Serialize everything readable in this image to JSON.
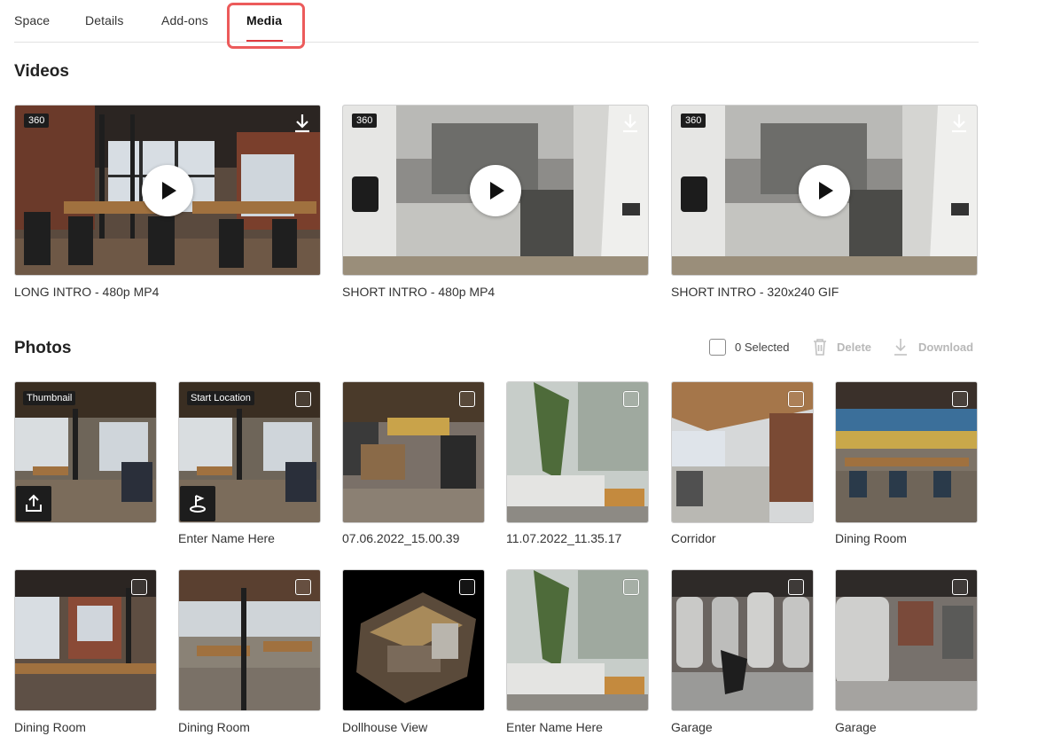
{
  "tabs": [
    {
      "label": "Space"
    },
    {
      "label": "Details"
    },
    {
      "label": "Add-ons"
    },
    {
      "label": "Media"
    }
  ],
  "videos": {
    "title": "Videos",
    "items": [
      {
        "label": "LONG INTRO - 480p MP4",
        "badge": "360"
      },
      {
        "label": "SHORT INTRO - 480p MP4",
        "badge": "360"
      },
      {
        "label": "SHORT INTRO - 320x240 GIF",
        "badge": "360"
      }
    ]
  },
  "photos": {
    "title": "Photos",
    "selected_text": "0 Selected",
    "delete_label": "Delete",
    "download_label": "Download",
    "items": [
      {
        "label": "",
        "tag": "Thumbnail"
      },
      {
        "label": "Enter Name Here",
        "tag": "Start Location"
      },
      {
        "label": "07.06.2022_15.00.39"
      },
      {
        "label": "11.07.2022_11.35.17"
      },
      {
        "label": "Corridor"
      },
      {
        "label": "Dining Room"
      },
      {
        "label": "Dining Room"
      },
      {
        "label": "Dining Room"
      },
      {
        "label": "Dollhouse View"
      },
      {
        "label": "Enter Name Here"
      },
      {
        "label": "Garage"
      },
      {
        "label": "Garage"
      }
    ]
  },
  "icons": {
    "download": "download-icon",
    "play": "play-icon",
    "trash": "trash-icon",
    "upload": "upload-icon",
    "start_location": "location-flag-icon"
  },
  "colors": {
    "accent": "#e0393e",
    "highlight_box": "#ec5b5b",
    "badge_bg": "#1d1d1d",
    "disabled_text": "#b8b8b8"
  }
}
